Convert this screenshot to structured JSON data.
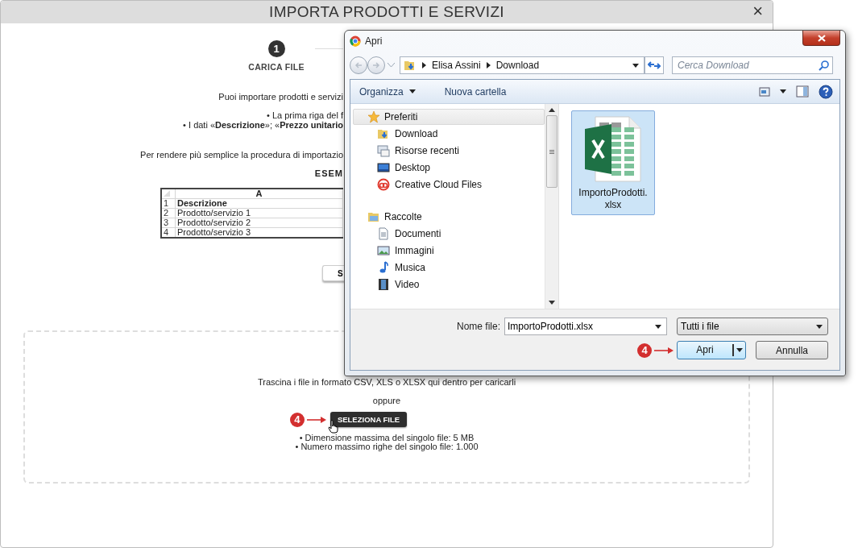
{
  "modal": {
    "title": "IMPORTA PRODOTTI E SERVIZI",
    "close": "×",
    "steps": [
      {
        "number": "1",
        "label": "CARICA FILE",
        "selected": true
      }
    ],
    "intro": [
      "Puoi importare prodotti e servizi",
      "• La prima riga del f",
      "• I dati «**Descrizione**»; «**Prezzo unitario**",
      "Per rendere più semplice la procedura di importazio"
    ],
    "example_title": "ESEM",
    "example_table": {
      "column": "A",
      "rows": [
        {
          "number": "1",
          "cell": "Descrizione",
          "header": true
        },
        {
          "number": "2",
          "cell": "Prodotto/servizio 1",
          "header": false
        },
        {
          "number": "3",
          "cell": "Prodotto/servizio 2",
          "header": false
        },
        {
          "number": "4",
          "cell": "Prodotto/servizio 3",
          "header": false
        }
      ]
    },
    "example_button": "S",
    "dropzone": {
      "instruction": "Trascina i file in formato CSV, XLS o XLSX qui dentro per caricarli",
      "separator": "oppure",
      "button": "SELEZIONA FILE",
      "marker": "4",
      "limits": [
        "• Dimensione massima del singolo file: 5 MB",
        "• Numero massimo righe del singolo file: 1.000"
      ]
    }
  },
  "dialog": {
    "title": "Apri",
    "path": [
      "Elisa Assini",
      "Download"
    ],
    "search": {
      "placeholder": "Cerca Download"
    },
    "toolbar": [
      {
        "label": "Organizza",
        "kind": "menu"
      },
      {
        "label": "Nuova cartella",
        "kind": "plain"
      }
    ],
    "nav": [
      {
        "label": "Preferiti",
        "selected": true,
        "children": [
          {
            "label": "Download",
            "selected": false
          },
          {
            "label": "Risorse recenti",
            "selected": false
          },
          {
            "label": "Desktop",
            "selected": false
          },
          {
            "label": "Creative Cloud Files",
            "selected": false
          }
        ]
      },
      {
        "label": "Raccolte",
        "selected": false,
        "children": [
          {
            "label": "Documenti",
            "selected": false
          },
          {
            "label": "Immagini",
            "selected": false
          },
          {
            "label": "Musica",
            "selected": false
          },
          {
            "label": "Video",
            "selected": false
          }
        ]
      }
    ],
    "files": [
      {
        "name": "ImportoProdotti.xlsx",
        "selected": true
      }
    ],
    "filename": {
      "label": "Nome file:",
      "value": "ImportoProdotti.xlsx"
    },
    "filetype": "Tutti i file",
    "buttons": [
      {
        "label": "Apri",
        "kind": "split",
        "marker": "4"
      },
      {
        "label": "Annulla",
        "kind": "plain"
      }
    ]
  }
}
